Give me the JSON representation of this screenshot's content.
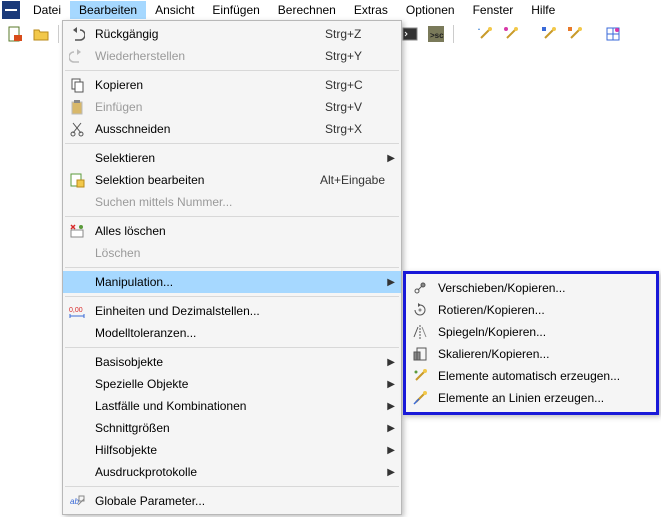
{
  "menubar": {
    "items": [
      "Datei",
      "Bearbeiten",
      "Ansicht",
      "Einfügen",
      "Berechnen",
      "Extras",
      "Optionen",
      "Fenster",
      "Hilfe"
    ],
    "active_index": 1
  },
  "toolbar": {
    "icons_left": [
      "new-file-icon",
      "open-file-icon"
    ],
    "icons_right": [
      "wand-star-icon",
      "wand-magenta-dot-icon",
      "wand-blue-icon",
      "wand-orange-box-icon",
      "grid-icon"
    ],
    "icons_mid": [
      "terminal-icon",
      "sc-icon"
    ]
  },
  "dropdown": {
    "groups": [
      [
        {
          "label": "Rückgängig",
          "shortcut": "Strg+Z",
          "icon": "undo-icon",
          "disabled": false,
          "submenu": false
        },
        {
          "label": "Wiederherstellen",
          "shortcut": "Strg+Y",
          "icon": "redo-icon",
          "disabled": true,
          "submenu": false
        }
      ],
      [
        {
          "label": "Kopieren",
          "shortcut": "Strg+C",
          "icon": "copy-icon",
          "disabled": false,
          "submenu": false
        },
        {
          "label": "Einfügen",
          "shortcut": "Strg+V",
          "icon": "paste-icon",
          "disabled": true,
          "submenu": false
        },
        {
          "label": "Ausschneiden",
          "shortcut": "Strg+X",
          "icon": "cut-icon",
          "disabled": false,
          "submenu": false
        }
      ],
      [
        {
          "label": "Selektieren",
          "shortcut": "",
          "icon": "",
          "disabled": false,
          "submenu": true
        },
        {
          "label": "Selektion bearbeiten",
          "shortcut": "Alt+Eingabe",
          "icon": "select-edit-icon",
          "disabled": false,
          "submenu": false
        },
        {
          "label": "Suchen mittels Nummer...",
          "shortcut": "",
          "icon": "",
          "disabled": true,
          "submenu": false
        }
      ],
      [
        {
          "label": "Alles löschen",
          "shortcut": "",
          "icon": "delete-all-icon",
          "disabled": false,
          "submenu": false
        },
        {
          "label": "Löschen",
          "shortcut": "",
          "icon": "",
          "disabled": true,
          "submenu": false
        }
      ],
      [
        {
          "label": "Manipulation...",
          "shortcut": "",
          "icon": "",
          "disabled": false,
          "submenu": true,
          "highlight": true
        }
      ],
      [
        {
          "label": "Einheiten und Dezimalstellen...",
          "shortcut": "",
          "icon": "units-icon",
          "disabled": false,
          "submenu": false
        },
        {
          "label": "Modelltoleranzen...",
          "shortcut": "",
          "icon": "",
          "disabled": false,
          "submenu": false
        }
      ],
      [
        {
          "label": "Basisobjekte",
          "shortcut": "",
          "icon": "",
          "disabled": false,
          "submenu": true
        },
        {
          "label": "Spezielle Objekte",
          "shortcut": "",
          "icon": "",
          "disabled": false,
          "submenu": true
        },
        {
          "label": "Lastfälle und Kombinationen",
          "shortcut": "",
          "icon": "",
          "disabled": false,
          "submenu": true
        },
        {
          "label": "Schnittgrößen",
          "shortcut": "",
          "icon": "",
          "disabled": false,
          "submenu": true
        },
        {
          "label": "Hilfsobjekte",
          "shortcut": "",
          "icon": "",
          "disabled": false,
          "submenu": true
        },
        {
          "label": "Ausdruckprotokolle",
          "shortcut": "",
          "icon": "",
          "disabled": false,
          "submenu": true
        }
      ],
      [
        {
          "label": "Globale Parameter...",
          "shortcut": "",
          "icon": "params-icon",
          "disabled": false,
          "submenu": false
        }
      ]
    ]
  },
  "submenu": {
    "items": [
      {
        "label": "Verschieben/Kopieren...",
        "icon": "move-copy-icon"
      },
      {
        "label": "Rotieren/Kopieren...",
        "icon": "rotate-copy-icon"
      },
      {
        "label": "Spiegeln/Kopieren...",
        "icon": "mirror-copy-icon"
      },
      {
        "label": "Skalieren/Kopieren...",
        "icon": "scale-copy-icon"
      },
      {
        "label": "Elemente automatisch erzeugen...",
        "icon": "auto-gen-icon"
      },
      {
        "label": "Elemente an Linien erzeugen...",
        "icon": "line-gen-icon"
      }
    ]
  }
}
